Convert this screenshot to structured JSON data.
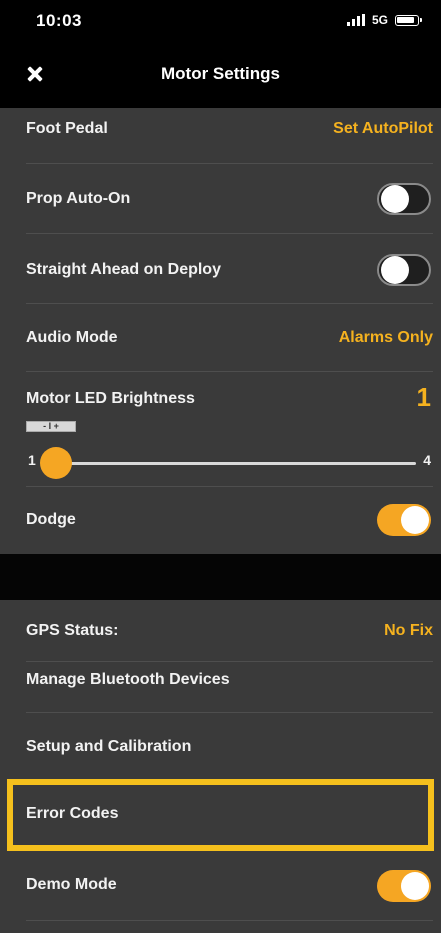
{
  "status_bar": {
    "time": "10:03",
    "network": "5G",
    "signal_icon": "signal-bars-icon",
    "battery_icon": "battery-icon"
  },
  "nav": {
    "title": "Motor Settings",
    "close_icon": "close-icon"
  },
  "colors": {
    "accent": "#f5a623",
    "value_text": "#f5b21f",
    "row_background": "#3a3a3a",
    "bar_background": "#000000",
    "highlight": "#f5c01d"
  },
  "settings": {
    "foot_pedal": {
      "label": "Foot Pedal",
      "value": "Set AutoPilot"
    },
    "prop_auto_on": {
      "label": "Prop Auto-On",
      "state": "off"
    },
    "straight_ahead": {
      "label": "Straight Ahead on Deploy",
      "state": "off"
    },
    "audio_mode": {
      "label": "Audio Mode",
      "value": "Alarms Only"
    },
    "led_brightness": {
      "label": "Motor LED Brightness",
      "value": "1",
      "mini_icon": "- I +",
      "min": "1",
      "max": "4",
      "level": 1
    },
    "dodge": {
      "label": "Dodge",
      "state": "on"
    },
    "gps_status": {
      "label": "GPS Status:",
      "value": "No Fix"
    },
    "manage_bluetooth": {
      "label": "Manage Bluetooth Devices"
    },
    "setup_calibration": {
      "label": "Setup and Calibration"
    },
    "error_codes": {
      "label": "Error Codes",
      "highlighted": true
    },
    "demo_mode": {
      "label": "Demo Mode",
      "state": "on"
    }
  }
}
